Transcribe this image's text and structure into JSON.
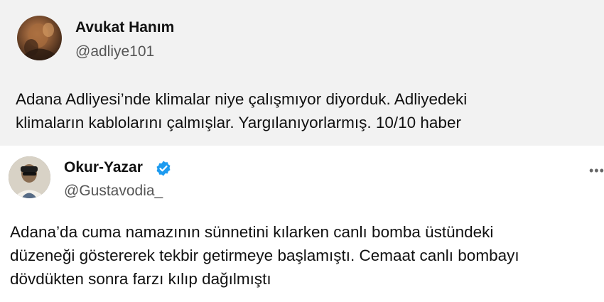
{
  "tweets": [
    {
      "name": "Avukat Hanım",
      "handle": "@adliye101",
      "verified": false,
      "text": "Adana Adliyesi’nde klimalar niye çalışmıyor diyorduk. Adliyedeki\nklimaların kablolarını çalmışlar. Yargılanıyorlarmış. 10/10 haber"
    },
    {
      "name": "Okur-Yazar",
      "handle": "@Gustavodia_",
      "verified": true,
      "more_icon": "more-dots-icon",
      "text": "Adana’da cuma namazının sünnetini kılarken canlı bomba üstündeki\ndüzeneği göstererek tekbir getirmeye başlamıştı. Cemaat canlı bombayı\ndövdükten sonra farzı kılıp dağılmıştı"
    }
  ],
  "colors": {
    "tweet1_background": "#f2f2f2",
    "tweet2_background": "#ffffff",
    "verified_badge": "#1d9bf0",
    "handle_text": "#555555"
  }
}
